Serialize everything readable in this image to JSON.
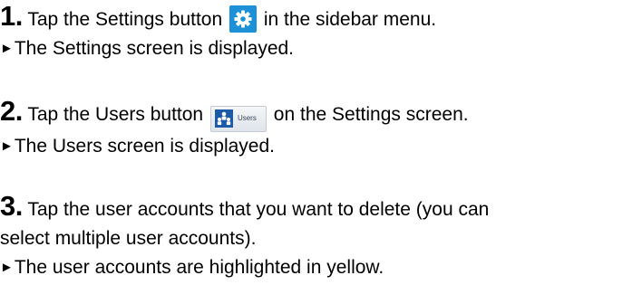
{
  "steps": [
    {
      "number": "1.",
      "text_before": "Tap the Settings button",
      "text_after": "in the sidebar menu.",
      "arrow": "►",
      "result": "The Settings screen is displayed."
    },
    {
      "number": "2.",
      "text_before": "Tap the Users button",
      "text_after": "on the Settings screen.",
      "button_label": "Users",
      "arrow": "►",
      "result": "The Users screen is displayed."
    },
    {
      "number": "3.",
      "text_line1": "Tap the user accounts that you want to delete (you can",
      "text_line2": "select multiple user accounts).",
      "arrow": "►",
      "result": "The user accounts are highlighted in yellow."
    }
  ],
  "icons": {
    "settings": "gear-icon",
    "users": "users-icon"
  },
  "colors": {
    "settings_button": "#1e90d8",
    "users_icon": "#1a5aa8"
  }
}
